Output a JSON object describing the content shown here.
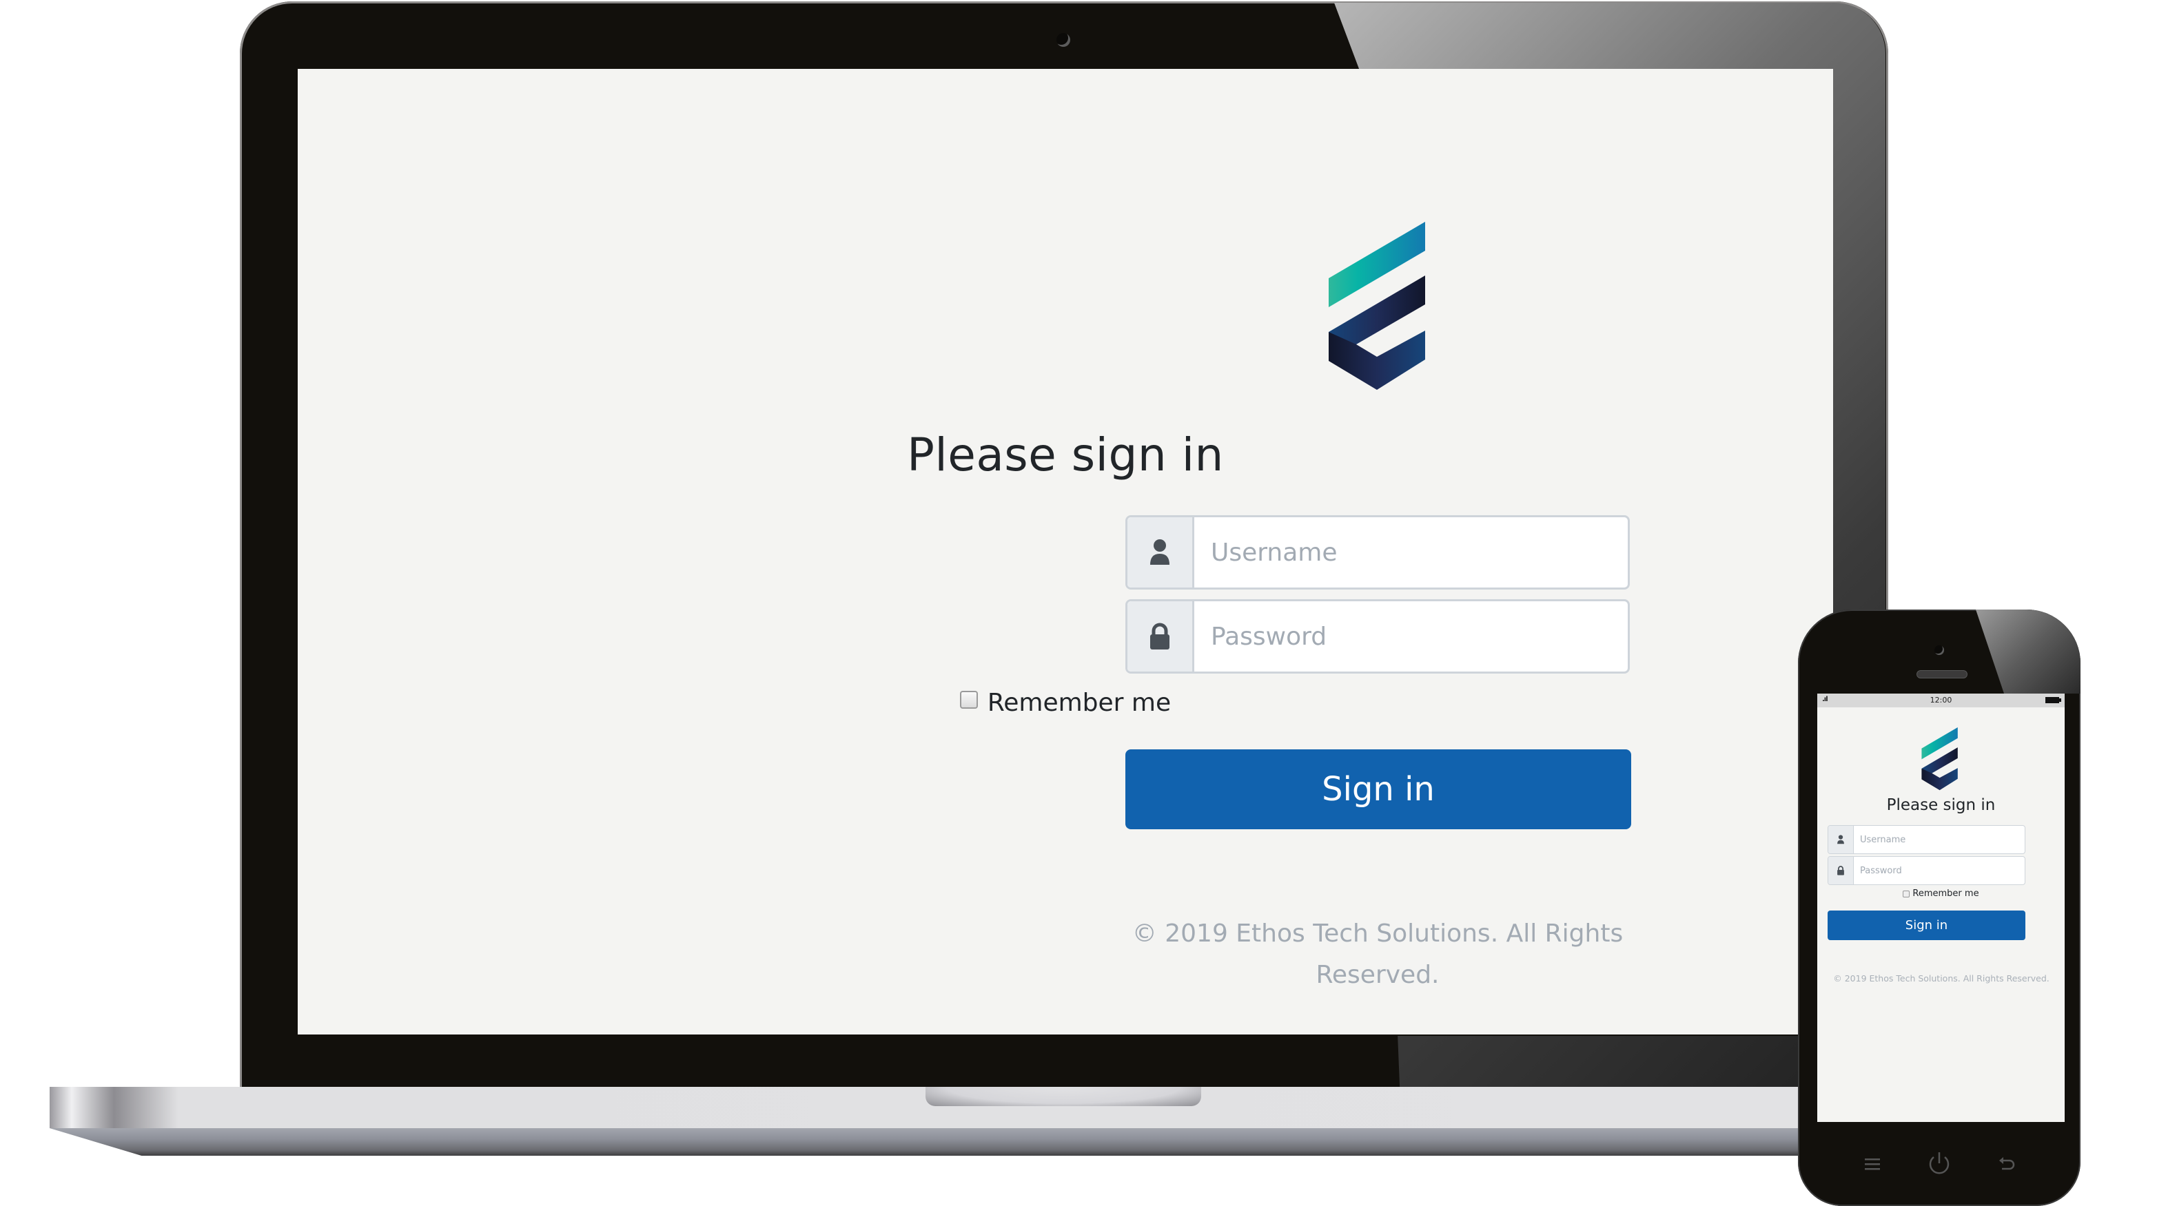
{
  "laptop": {
    "login": {
      "title": "Please sign in",
      "username": {
        "placeholder": "Username",
        "value": "",
        "icon": "user-icon"
      },
      "password": {
        "placeholder": "Password",
        "value": "",
        "icon": "lock-icon"
      },
      "remember_me": {
        "label": "Remember me",
        "checked": false
      },
      "signin_label": "Sign in",
      "footer": "© 2019 Ethos Tech Solutions. All Rights Reserved."
    }
  },
  "phone": {
    "status_bar": {
      "time": "12:00",
      "signal_icon": "signal-icon",
      "battery_icon": "battery-icon"
    },
    "login": {
      "title": "Please sign in",
      "username": {
        "placeholder": "Username",
        "value": "",
        "icon": "user-icon"
      },
      "password": {
        "placeholder": "Password",
        "value": "",
        "icon": "lock-icon"
      },
      "remember_me": {
        "label": "Remember me",
        "checked": false
      },
      "signin_label": "Sign in",
      "footer": "© 2019 Ethos Tech Solutions. All Rights Reserved."
    },
    "nav_buttons": [
      "menu-icon",
      "power-icon",
      "back-icon"
    ]
  },
  "colors": {
    "brand_primary": "#1162ae",
    "logo_teal": "#0fb3a3",
    "logo_blue": "#137ab0",
    "logo_navy": "#1b2a52",
    "screen_bg": "#f4f4f2",
    "muted_text": "#a2aab3"
  }
}
